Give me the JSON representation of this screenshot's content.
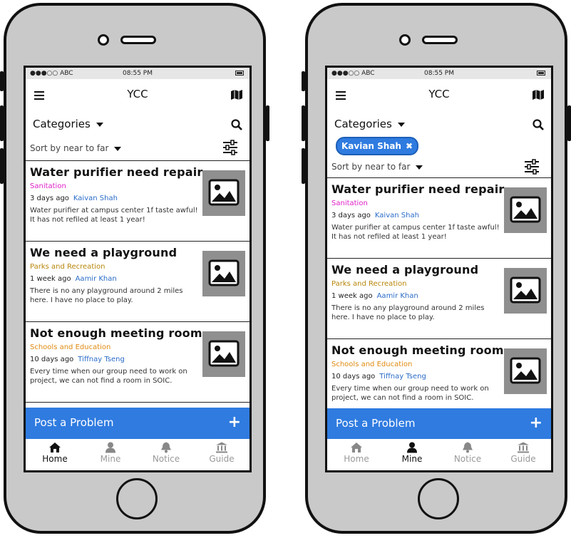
{
  "left": {
    "status": {
      "carrier": "●●●○○ ABC",
      "time": "08:55 PM"
    },
    "header": {
      "title": "YCC"
    },
    "categories_label": "Categories",
    "sort_label": "Sort by near to far",
    "items": [
      {
        "title": "Water purifier need repair",
        "category": "Sanitation",
        "category_color": "#e020c8",
        "age": "3 days ago",
        "author": "Kaivan Shah",
        "desc": "Water purifier at campus center 1f taste awful! It has not refiled at least 1 year!"
      },
      {
        "title": "We need a playground",
        "category": "Parks and Recreation",
        "category_color": "#b8860b",
        "age": "1 week ago",
        "author": "Aamir Khan",
        "desc": "There is no any playground around 2 miles here. I have no place to play."
      },
      {
        "title": "Not enough meeting room",
        "category": "Schools and Education",
        "category_color": "#e08a10",
        "age": "10 days ago",
        "author": "Tiffnay Tseng",
        "desc": "Every time when our group need to work on project, we can not find a room in SOIC."
      }
    ],
    "post_label": "Post a Problem",
    "tabs": [
      {
        "label": "Home",
        "icon": "home-icon"
      },
      {
        "label": "Mine",
        "icon": "user-icon"
      },
      {
        "label": "Notice",
        "icon": "bell-icon"
      },
      {
        "label": "Guide",
        "icon": "bank-icon"
      }
    ]
  },
  "right": {
    "status": {
      "carrier": "●●●○○ ABC",
      "time": "08:55 PM"
    },
    "header": {
      "title": "YCC"
    },
    "categories_label": "Categories",
    "filter_chip": "Kavian Shah",
    "sort_label": "Sort by near to far",
    "items": [
      {
        "title": "Water purifier need repair",
        "category": "Sanitation",
        "category_color": "#e020c8",
        "age": "3 days ago",
        "author": "Kaivan Shah",
        "desc": "Water purifier at campus center 1f taste awful! It has not refiled at least 1 year!"
      },
      {
        "title": "We need a playground",
        "category": "Parks and Recreation",
        "category_color": "#b8860b",
        "age": "1 week ago",
        "author": "Aamir Khan",
        "desc": "There is no any playground around 2 miles here. I have no place to play."
      },
      {
        "title": "Not enough meeting room",
        "category": "Schools and Education",
        "category_color": "#e08a10",
        "age": "10 days ago",
        "author": "Tiffnay Tseng",
        "desc": "Every time when our group need to work on project, we can not find a room in SOIC."
      }
    ],
    "post_label": "Post a Problem",
    "tabs": [
      {
        "label": "Home",
        "icon": "home-icon"
      },
      {
        "label": "Mine",
        "icon": "user-icon"
      },
      {
        "label": "Notice",
        "icon": "bell-icon"
      },
      {
        "label": "Guide",
        "icon": "bank-icon"
      }
    ]
  },
  "accent_color": "#2f7be0"
}
